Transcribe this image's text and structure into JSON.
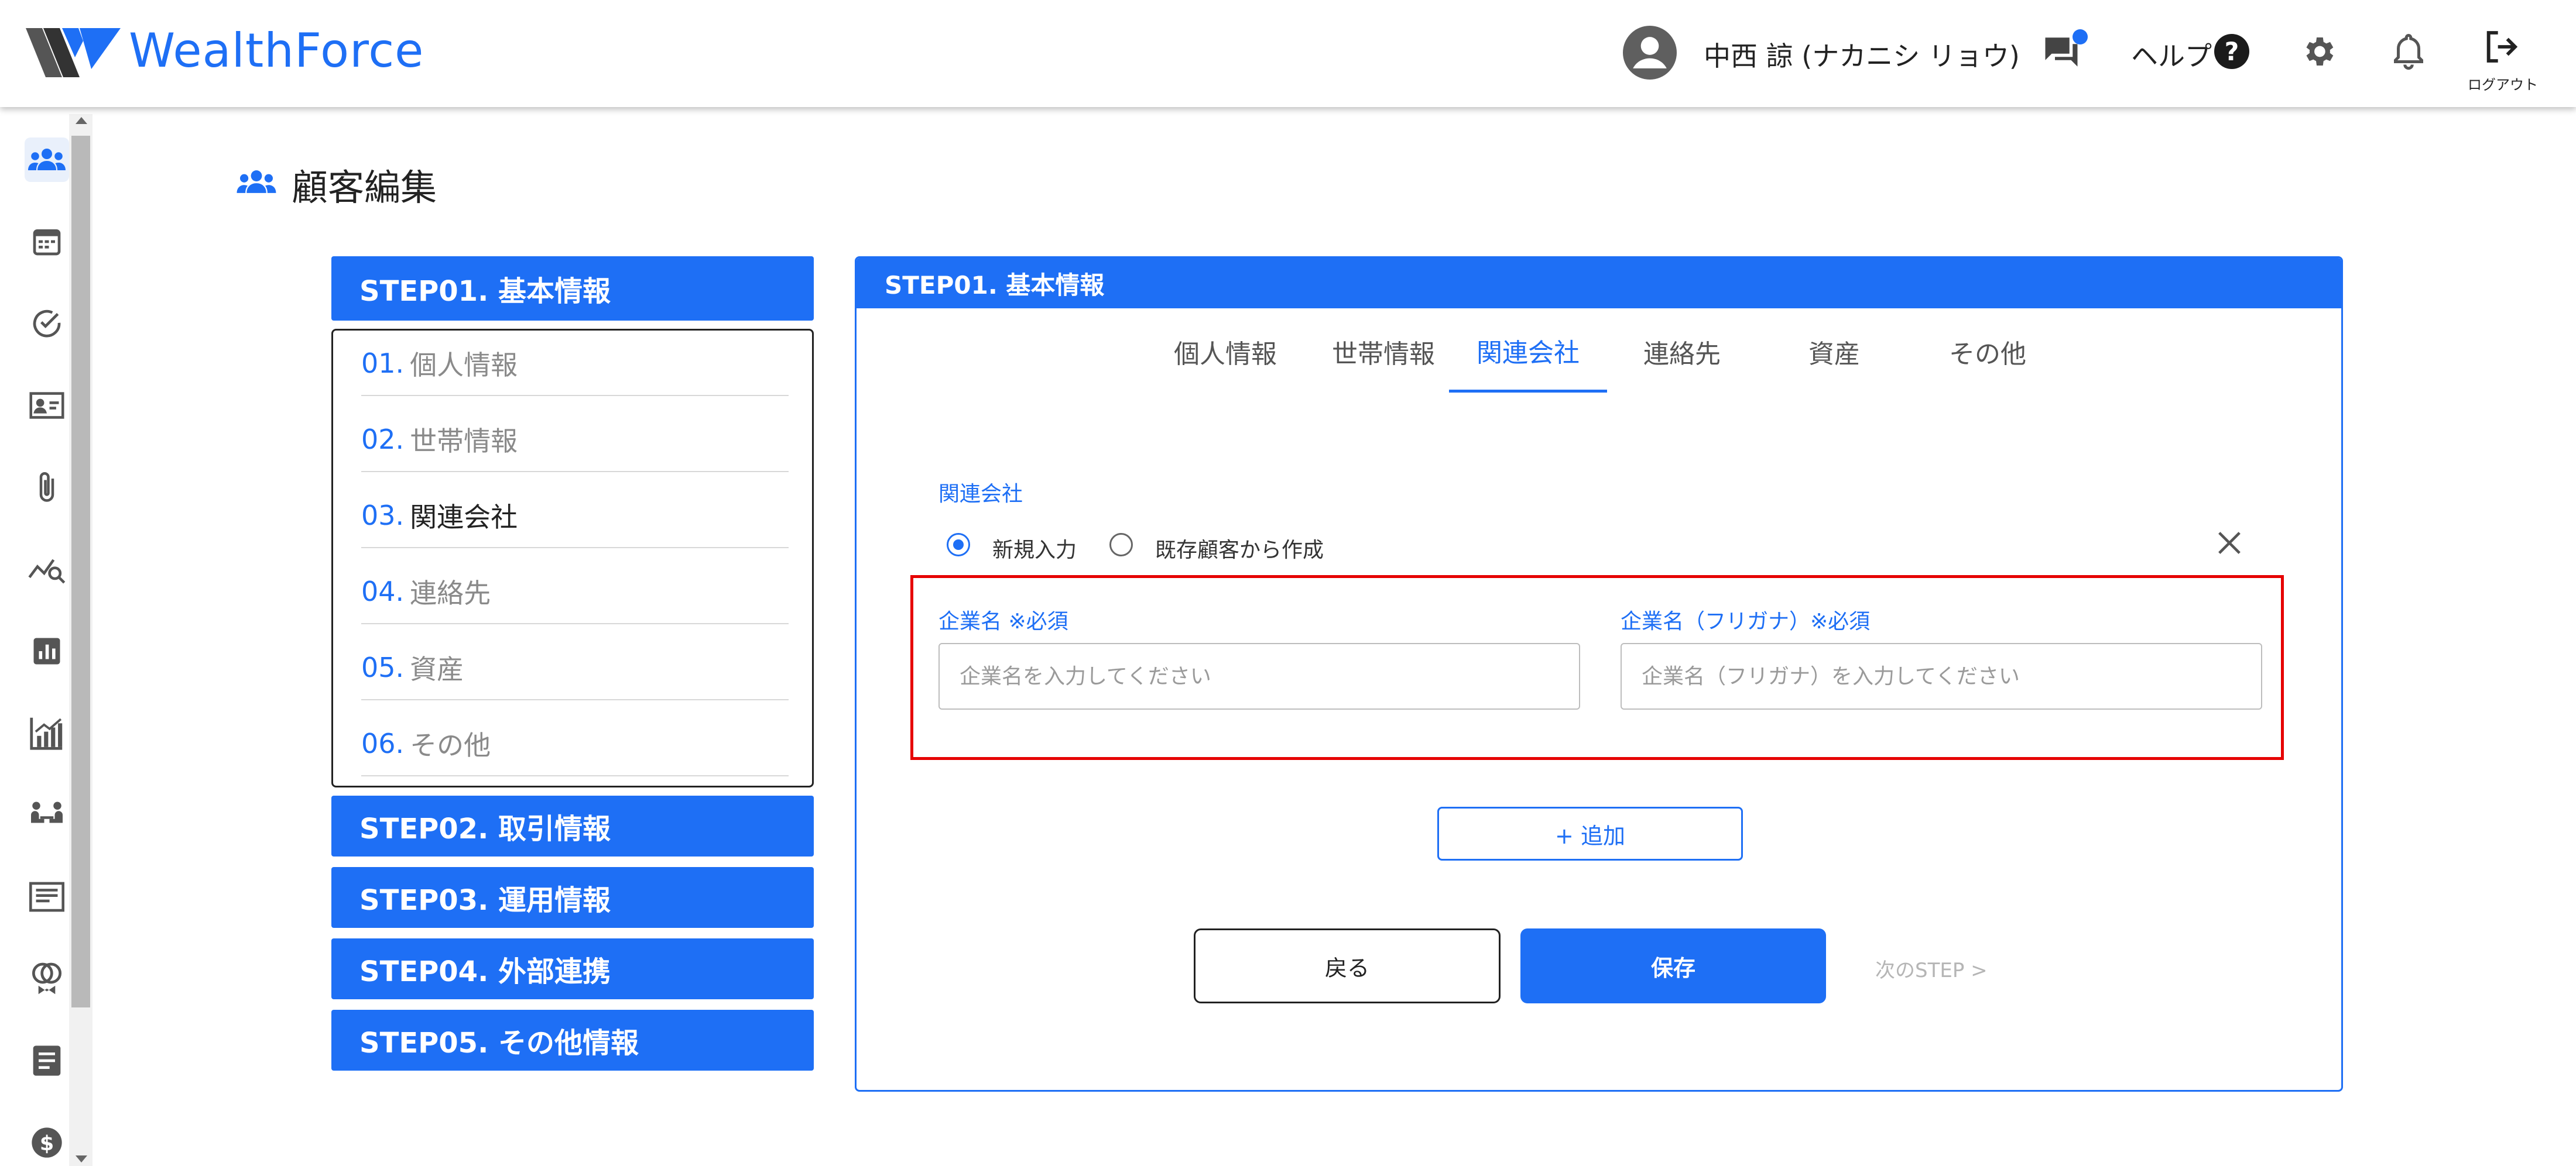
{
  "app": {
    "brand": "WealthForce",
    "accent_color": "#1e6ff5"
  },
  "header": {
    "user_name": "中西 諒 (ナカニシ リョウ)",
    "help_label": "ヘルプ",
    "logout_label": "ログアウト",
    "icons": [
      "user-avatar-icon",
      "chat-icon",
      "help-icon",
      "gear-icon",
      "bell-icon",
      "logout-icon"
    ]
  },
  "sidebar": {
    "icons": [
      "customers-icon",
      "calendar-icon",
      "check-circle-icon",
      "id-card-icon",
      "paperclip-icon",
      "chart-search-icon",
      "bar-chart-icon",
      "growth-chart-icon",
      "meeting-icon",
      "document-icon",
      "rings-icon",
      "notes-icon",
      "dollar-icon"
    ],
    "active_index": 0
  },
  "page": {
    "title": "顧客編集"
  },
  "steps": {
    "step1": "STEP01. 基本情報",
    "step2": "STEP02. 取引情報",
    "step3": "STEP03. 運用情報",
    "step4": "STEP04. 外部連携",
    "step5": "STEP05. その他情報",
    "sub_items": [
      {
        "num": "01.",
        "label": "個人情報",
        "active": false
      },
      {
        "num": "02.",
        "label": "世帯情報",
        "active": false
      },
      {
        "num": "03.",
        "label": "関連会社",
        "active": true
      },
      {
        "num": "04.",
        "label": "連絡先",
        "active": false
      },
      {
        "num": "05.",
        "label": "資産",
        "active": false
      },
      {
        "num": "06.",
        "label": "その他",
        "active": false
      }
    ]
  },
  "panel": {
    "heading": "STEP01. 基本情報",
    "tabs": [
      "個人情報",
      "世帯情報",
      "関連会社",
      "連絡先",
      "資産",
      "その他"
    ],
    "active_tab": "関連会社",
    "section_label": "関連会社",
    "radio_new": "新規入力",
    "radio_existing": "既存顧客から作成",
    "radio_selected": "新規入力",
    "company_name_label": "企業名 ※必須",
    "company_name_placeholder": "企業名を入力してください",
    "company_name_value": "",
    "company_kana_label": "企業名（フリガナ）※必須",
    "company_kana_placeholder": "企業名（フリガナ）を入力してください",
    "company_kana_value": "",
    "add_button": "+ 追加",
    "back_button": "戻る",
    "save_button": "保存",
    "next_step": "次のSTEP >"
  }
}
